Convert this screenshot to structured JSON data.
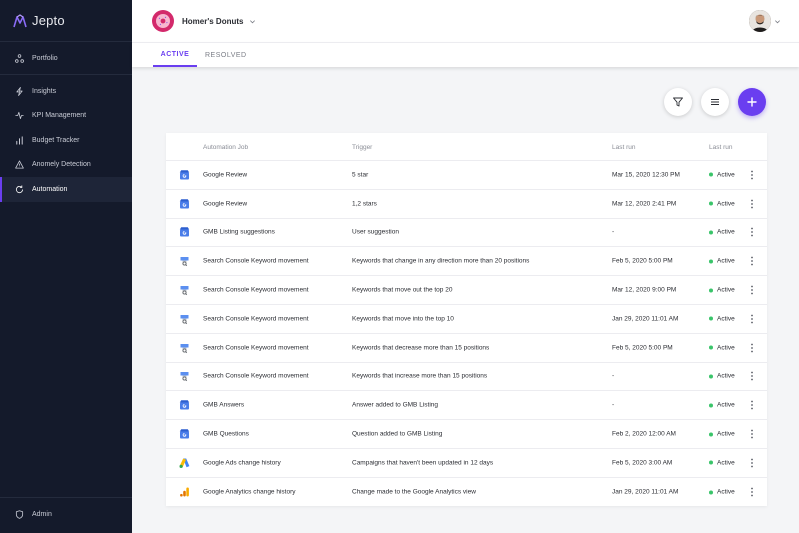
{
  "app": {
    "logo_text": "Jepto"
  },
  "sidebar": {
    "top_item": {
      "label": "Portfolio",
      "icon": "portfolio-icon"
    },
    "items": [
      {
        "label": "Insights",
        "icon": "bolt-icon"
      },
      {
        "label": "KPI Management",
        "icon": "pulse-icon"
      },
      {
        "label": "Budget Tracker",
        "icon": "bar-chart-icon"
      },
      {
        "label": "Anomely Detection",
        "icon": "warning-icon"
      },
      {
        "label": "Automation",
        "icon": "refresh-icon",
        "active": true
      }
    ],
    "bottom_item": {
      "label": "Admin",
      "icon": "shield-icon"
    }
  },
  "topbar": {
    "account_name": "Homer's Donuts"
  },
  "tabs": {
    "active": "ACTIVE",
    "resolved": "RESOLVED"
  },
  "table": {
    "headers": {
      "job": "Automation Job",
      "trigger": "Trigger",
      "last_run": "Last run",
      "status": "Last run"
    },
    "rows": [
      {
        "icon": "gmb-icon",
        "job": "Google Review",
        "trigger": "5 star",
        "last_run": "Mar 15, 2020 12:30 PM",
        "status": "Active"
      },
      {
        "icon": "gmb-icon",
        "job": "Google Review",
        "trigger": "1,2 stars",
        "last_run": "Mar 12, 2020 2:41 PM",
        "status": "Active"
      },
      {
        "icon": "gmb-icon",
        "job": "GMB Listing suggestions",
        "trigger": "User suggestion",
        "last_run": "-",
        "status": "Active"
      },
      {
        "icon": "search-console-icon",
        "job": "Search Console Keyword movement",
        "trigger": "Keywords that change in any direction more than 20 positions",
        "last_run": "Feb 5, 2020 5:00 PM",
        "status": "Active"
      },
      {
        "icon": "search-console-icon",
        "job": "Search Console Keyword movement",
        "trigger": "Keywords that move out the top 20",
        "last_run": "Mar 12, 2020 9:00 PM",
        "status": "Active"
      },
      {
        "icon": "search-console-icon",
        "job": "Search Console Keyword movement",
        "trigger": "Keywords that move into the top 10",
        "last_run": "Jan 29, 2020 11:01 AM",
        "status": "Active"
      },
      {
        "icon": "search-console-icon",
        "job": "Search Console Keyword movement",
        "trigger": "Keywords that decrease more than 15 positions",
        "last_run": "Feb 5, 2020 5:00 PM",
        "status": "Active"
      },
      {
        "icon": "search-console-icon",
        "job": "Search Console Keyword movement",
        "trigger": "Keywords that increase more than 15 positions",
        "last_run": "-",
        "status": "Active"
      },
      {
        "icon": "gmb-icon",
        "job": "GMB Answers",
        "trigger": "Answer added to GMB Listing",
        "last_run": "-",
        "status": "Active"
      },
      {
        "icon": "gmb-icon",
        "job": "GMB Questions",
        "trigger": "Question added to GMB Listing",
        "last_run": "Feb 2, 2020 12:00 AM",
        "status": "Active"
      },
      {
        "icon": "google-ads-icon",
        "job": "Google Ads change history",
        "trigger": "Campaigns that haven't been updated in 12 days",
        "last_run": "Feb 5, 2020 3:00 AM",
        "status": "Active"
      },
      {
        "icon": "google-analytics-icon",
        "job": "Google Analytics change history",
        "trigger": "Change made to the Google Analytics view",
        "last_run": "Jan 29, 2020 11:01 AM",
        "status": "Active"
      }
    ]
  },
  "colors": {
    "accent": "#6a3ef0",
    "sidebar_bg": "#141a2b",
    "status_active": "#3ac46a"
  }
}
